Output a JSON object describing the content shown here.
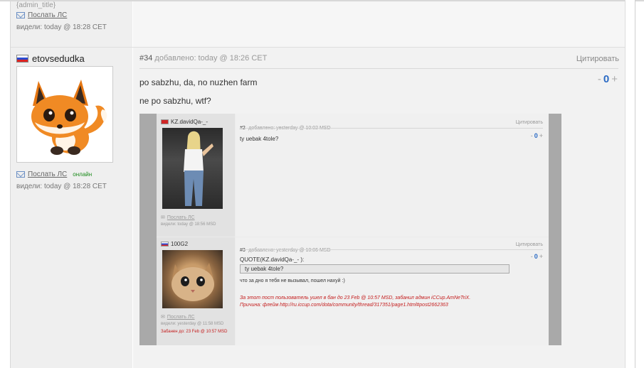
{
  "prev_post": {
    "admin_title": "{admin_title}",
    "pm_label": "Послать ЛС",
    "seen_label": "видели: today @ 18:28 CET"
  },
  "post": {
    "author": "etovsedudka",
    "pm_label": "Послать ЛС",
    "online_label": "онлайн",
    "seen_label": "видели: today @ 18:28 CET",
    "number": "#34",
    "added_label": "добавлено: today @ 18:26 CET",
    "quote_label": "Цитировать",
    "rating": {
      "minus": "-",
      "value": "0",
      "plus": "+"
    },
    "lines": [
      "po sabzhu, da, no nuzhen farm",
      "ne po sabzhu, wtf?"
    ]
  },
  "screenshot": {
    "post2": {
      "author": "KZ.davidQa-_-",
      "number": "#2",
      "added_label": "добавлено: yesterday @ 10:02 MSD",
      "quote_label": "Цитировать",
      "rating": {
        "minus": "-",
        "value": "0",
        "plus": "+"
      },
      "text": "ty uebak 4tole?",
      "pm_label": "Послать ЛС",
      "seen_label": "видели: today @ 18:56 MSD"
    },
    "post3": {
      "author": "100G2",
      "number": "#3",
      "added_label": "добавлено: yesterday @ 10:06 MSD",
      "quote_label": "Цитировать",
      "rating": {
        "minus": "-",
        "value": "0",
        "plus": "+"
      },
      "quote_header": "QUOTE(KZ.davidQa-_- ):",
      "quote_text": "ty uebak 4tole?",
      "text": "что за дно я тебя не вызывал, пошел нахуй :)",
      "ban_line1": "За этот пост пользователь ушел в бан до 23 Feb @ 10:57 MSD, забанил админ iCCup.AmNeTriX.",
      "ban_line2": "Причина: флейм http://ru.iccup.com/dota/community/thread/317351/page1.html#post2662363",
      "pm_label": "Послать ЛС",
      "seen_label": "видели: yesterday @ 11:58 MSD",
      "banned_label": "Забанен до: 23 Feb @ 10:57 MSD"
    }
  }
}
